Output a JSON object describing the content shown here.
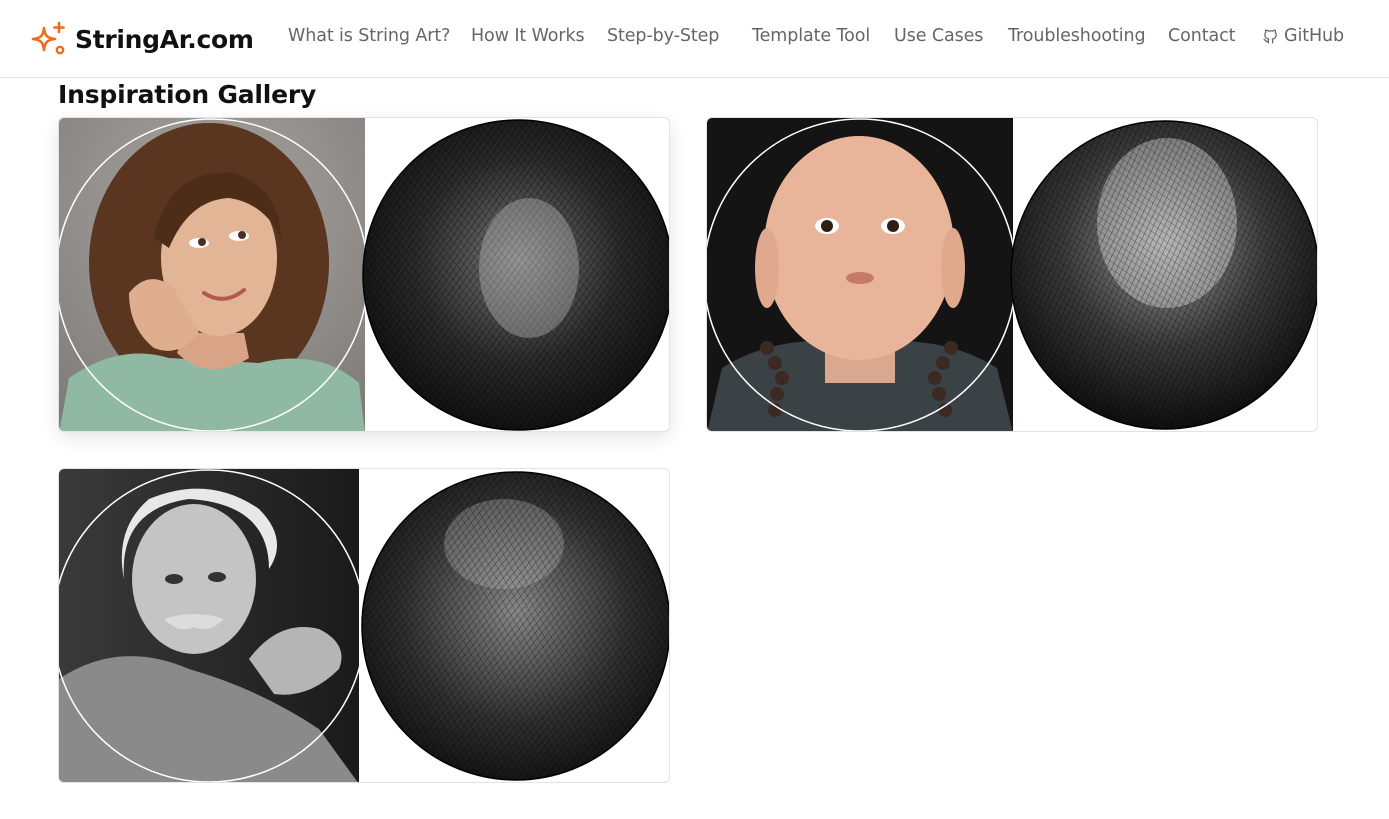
{
  "brand": {
    "name": "StringAr.com",
    "icon": "sparkle-icon",
    "color": "#f26a1b"
  },
  "nav": {
    "items": [
      {
        "label": "What is String Art?"
      },
      {
        "label": "How It Works"
      },
      {
        "label": "Step-by-Step"
      },
      {
        "label": "Template Tool"
      },
      {
        "label": "Use Cases"
      },
      {
        "label": "Troubleshooting"
      },
      {
        "label": "Contact"
      },
      {
        "label": "GitHub",
        "icon": "github-icon"
      }
    ]
  },
  "gallery": {
    "title": "Inspiration Gallery",
    "items": [
      {
        "subject": "woman-portrait",
        "original": "color photo",
        "result": "string art"
      },
      {
        "subject": "baby-monk-portrait",
        "original": "color photo",
        "result": "string art"
      },
      {
        "subject": "einstein-portrait",
        "original": "black and white photo",
        "result": "string art"
      }
    ]
  }
}
